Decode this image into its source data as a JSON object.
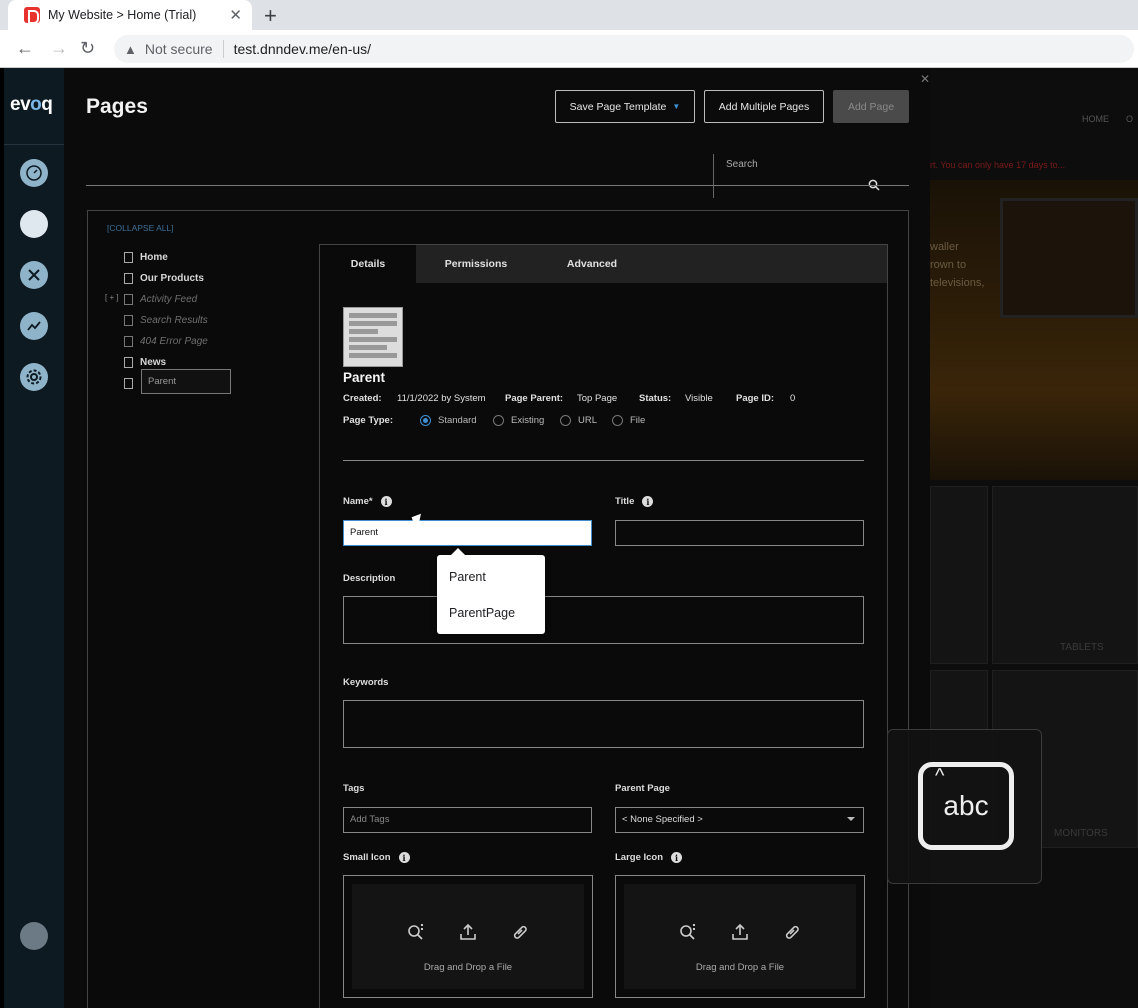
{
  "browser": {
    "tab_title": "My Website > Home (Trial)",
    "security_label": "Not secure",
    "url": "test.dnndev.me/en-us/"
  },
  "sidebar": {
    "logo_left": "ev",
    "logo_accent": "o",
    "logo_right": "q",
    "icons": [
      "dashboard-icon",
      "content-icon",
      "tools-icon",
      "analytics-icon",
      "settings-icon",
      "user-avatar-icon"
    ]
  },
  "header": {
    "title": "Pages",
    "save_template_label": "Save Page Template",
    "add_multiple_label": "Add Multiple Pages",
    "add_page_label": "Add Page",
    "search_placeholder": "Search"
  },
  "tree": {
    "collapse_label": "[COLLAPSE ALL]",
    "toggle_label": "[ + ]",
    "items": [
      {
        "label": "Home",
        "style": "bold"
      },
      {
        "label": "Our Products",
        "style": "bold"
      },
      {
        "label": "Activity Feed",
        "style": "italic"
      },
      {
        "label": "Search Results",
        "style": "italic"
      },
      {
        "label": "404 Error Page",
        "style": "italic"
      },
      {
        "label": "News",
        "style": "bold"
      }
    ],
    "new_item_value": "Parent"
  },
  "details": {
    "tabs": [
      "Details",
      "Permissions",
      "Advanced"
    ],
    "page_name": "Parent",
    "created_label": "Created:",
    "created_value": "11/1/2022 by System",
    "parent_label": "Page Parent:",
    "parent_value": "Top Page",
    "status_label": "Status:",
    "status_value": "Visible",
    "id_label": "Page ID:",
    "id_value": "0",
    "page_type_label": "Page Type:",
    "page_types": [
      "Standard",
      "Existing",
      "URL",
      "File"
    ],
    "selected_page_type": "Standard",
    "name_label": "Name*",
    "name_value": "Parent",
    "title_label": "Title",
    "title_value": "",
    "description_label": "Description",
    "keywords_label": "Keywords",
    "tags_label": "Tags",
    "tags_placeholder": "Add Tags",
    "parent_page_label": "Parent Page",
    "parent_page_value": "< None Specified >",
    "small_icon_label": "Small Icon",
    "large_icon_label": "Large Icon",
    "dropzone_text": "Drag and Drop a File"
  },
  "autocomplete": {
    "options": [
      "Parent",
      "ParentPage"
    ]
  },
  "background_site": {
    "nav_home": "HOME",
    "nav_next": "O",
    "trial_warning": "rt. You can only have 17 days to...",
    "hero_lines": [
      "waller",
      "rown to",
      "televisions,"
    ],
    "label_tablets": "TABLETS",
    "label_monitors": "MONITORS"
  },
  "handwriting": {
    "key_label": "abc"
  },
  "colors": {
    "accent": "#3f8fd0",
    "sidebar_bg": "#0e1a22",
    "panel_bg": "#0b0b0b"
  }
}
